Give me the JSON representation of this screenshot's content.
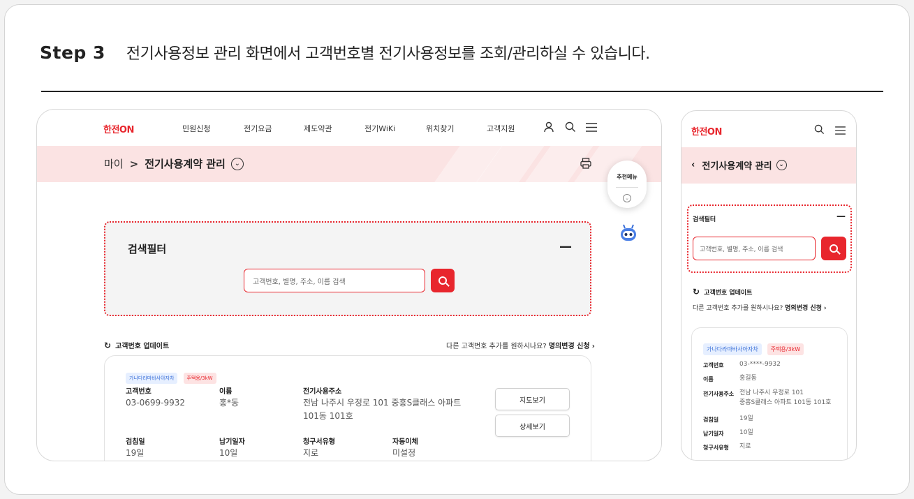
{
  "step": {
    "number": "Step 3",
    "description": "전기사용정보 관리 화면에서 고객번호별 전기사용정보를 조회/관리하실 수 있습니다."
  },
  "logo": {
    "text": "한전",
    "suffix": "ON"
  },
  "desktop": {
    "nav": [
      "민원신청",
      "전기요금",
      "제도약관",
      "전기WiKi",
      "위치찾기",
      "고객지원"
    ],
    "breadcrumb": {
      "parent": "마이",
      "separator": ">",
      "current": "전기사용계약 관리"
    },
    "filter": {
      "title": "검색필터",
      "placeholder": "고객번호, 별명, 주소, 이름 검색"
    },
    "update_label": "고객번호 업데이트",
    "request": {
      "question": "다른 고객번호 추가를 원하시나요?",
      "link": "명의변경 신청"
    },
    "result": {
      "badges": [
        "가나다라마바사아자차",
        "주택용/3kW"
      ],
      "customer_no_label": "고객번호",
      "customer_no": "03-0699-9932",
      "name_label": "이름",
      "name": "홍*동",
      "address_label": "전기사용주소",
      "address": "전남 나주시 우정로 101 중흥S클래스 아파트 101동 101호",
      "meter_label": "검침일",
      "meter": "19일",
      "due_label": "납기일자",
      "due": "10일",
      "bill_label": "청구서유형",
      "bill": "지로",
      "auto_label": "자동이체",
      "auto": "미설정",
      "btn_map": "지도보기",
      "btn_detail": "상세보기"
    }
  },
  "float_menu": {
    "label": "추천메뉴"
  },
  "mobile": {
    "breadcrumb": "전기사용계약 관리",
    "filter": {
      "title": "검색필터",
      "placeholder": "고객번호, 별명, 주소, 이름 검색"
    },
    "update_label": "고객번호 업데이트",
    "request": {
      "question": "다른 고객번호 추가를 원하시나요?",
      "link": "명의변경 신청"
    },
    "result": {
      "badges": [
        "가나다라마바사아자차",
        "주택용/3kW"
      ],
      "customer_no_label": "고객번호",
      "customer_no": "03-****-9932",
      "name_label": "이름",
      "name": "홍길동",
      "address_label": "전기사용주소",
      "address_line1": "전남 나주시 우정로 101",
      "address_line2": "중흥S클래스 아파트 101동 101호",
      "meter_label": "검침일",
      "meter": "19일",
      "due_label": "납기일자",
      "due": "10일",
      "bill_label": "청구서유형",
      "bill": "지로"
    }
  },
  "colors": {
    "accent": "#e8262d",
    "pink_band": "#fbe3e3",
    "badge_blue": "#3a6fd8"
  }
}
